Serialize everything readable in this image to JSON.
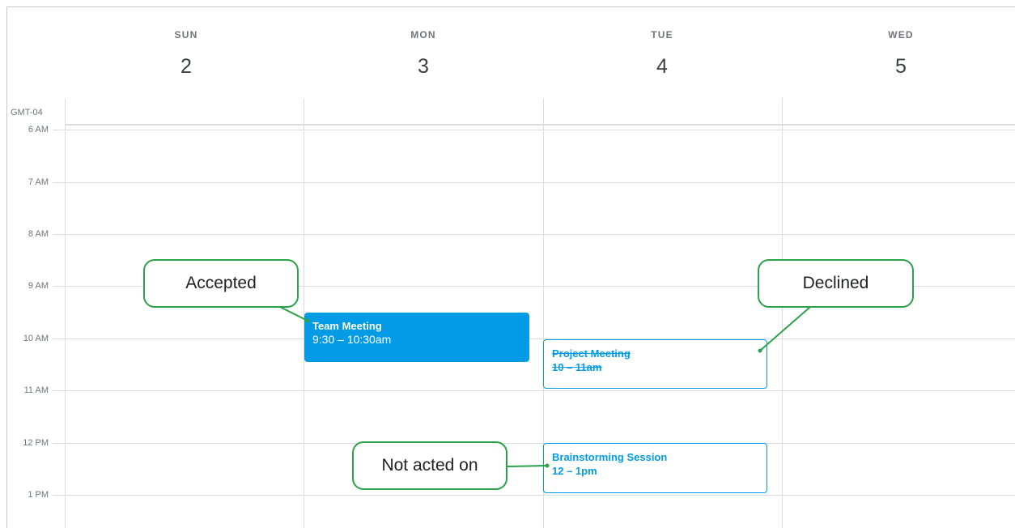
{
  "calendar": {
    "timezone": "GMT-04",
    "days": [
      {
        "name": "SUN",
        "number": "2"
      },
      {
        "name": "MON",
        "number": "3"
      },
      {
        "name": "TUE",
        "number": "4"
      },
      {
        "name": "WED",
        "number": "5"
      }
    ],
    "hours": [
      "6 AM",
      "7 AM",
      "8 AM",
      "9 AM",
      "10 AM",
      "11 AM",
      "12 PM",
      "1 PM"
    ],
    "events": {
      "accepted": {
        "title": "Team Meeting",
        "time": "9:30 – 10:30am",
        "status": "accepted"
      },
      "declined": {
        "title": "Project Meeting",
        "time": "10 – 11am",
        "status": "declined"
      },
      "pending": {
        "title": "Brainstorming Session",
        "time": "12 – 1pm",
        "status": "not acted on"
      }
    },
    "colors": {
      "event_blue": "#039be5",
      "callout_green": "#2aa34a",
      "grid": "#dadce0"
    }
  },
  "callouts": {
    "accepted": "Accepted",
    "declined": "Declined",
    "pending": "Not acted on"
  }
}
